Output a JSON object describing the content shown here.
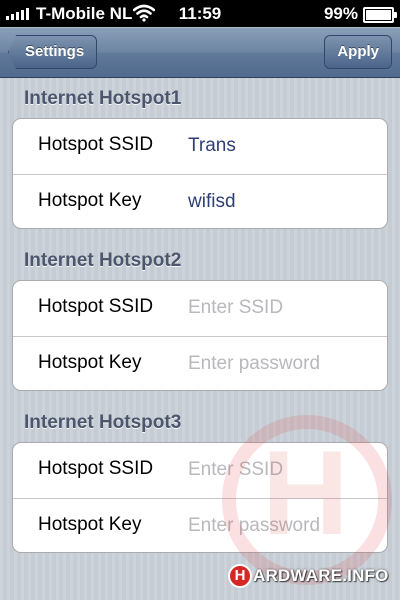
{
  "status_bar": {
    "carrier": "T-Mobile NL",
    "time": "11:59",
    "battery_percent_label": "99%",
    "battery_level": 0.99,
    "wifi_icon": "wifi-icon",
    "signal_icon": "signal-strength-icon"
  },
  "nav": {
    "back_label": "Settings",
    "apply_label": "Apply"
  },
  "sections": [
    {
      "header": "Internet Hotspot1",
      "rows": [
        {
          "label": "Hotspot SSID",
          "value": "Trans",
          "placeholder": ""
        },
        {
          "label": "Hotspot Key",
          "value": "wifisd",
          "placeholder": ""
        }
      ]
    },
    {
      "header": "Internet Hotspot2",
      "rows": [
        {
          "label": "Hotspot SSID",
          "value": "",
          "placeholder": "Enter SSID"
        },
        {
          "label": "Hotspot Key",
          "value": "",
          "placeholder": "Enter password"
        }
      ]
    },
    {
      "header": "Internet Hotspot3",
      "rows": [
        {
          "label": "Hotspot SSID",
          "value": "",
          "placeholder": "Enter SSID"
        },
        {
          "label": "Hotspot Key",
          "value": "",
          "placeholder": "Enter password"
        }
      ]
    }
  ],
  "watermark": {
    "logo_letter": "H",
    "brand_text": "ARDWARE.INFO"
  },
  "colors": {
    "nav_bar": "#6e86a3",
    "background": "#c5ccd4",
    "value_text": "#2f3f73",
    "placeholder_text": "#b8b8bd",
    "section_header": "#4c566c",
    "brand_red": "#d62727"
  }
}
